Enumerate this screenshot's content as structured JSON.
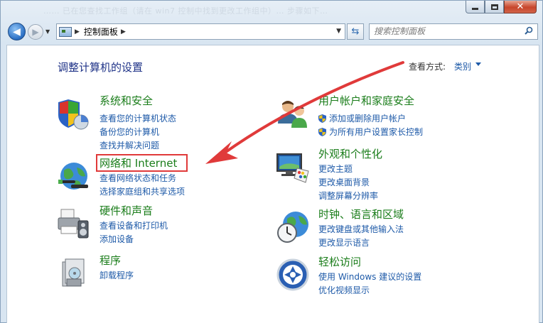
{
  "window": {
    "title_blurred": "…… 已在您查找工作组（请在 win7 控制中找到更改工作组中）… 步骤如下…",
    "minimize_label": "",
    "maximize_label": "",
    "close_label": "✕"
  },
  "nav": {
    "breadcrumb": "控制面板",
    "search_placeholder": "搜索控制面板"
  },
  "content": {
    "heading": "调整计算机的设置",
    "view_by_label": "查看方式:",
    "view_by_value": "类别"
  },
  "categories": {
    "system": {
      "title": "系统和安全",
      "links": [
        "查看您的计算机状态",
        "备份您的计算机",
        "查找并解决问题"
      ]
    },
    "network": {
      "title": "网络和 Internet",
      "links": [
        "查看网络状态和任务",
        "选择家庭组和共享选项"
      ]
    },
    "hardware": {
      "title": "硬件和声音",
      "links": [
        "查看设备和打印机",
        "添加设备"
      ]
    },
    "programs": {
      "title": "程序",
      "links": [
        "卸载程序"
      ]
    },
    "users": {
      "title": "用户帐户和家庭安全",
      "links": [
        "添加或删除用户帐户",
        "为所有用户设置家长控制"
      ]
    },
    "appearance": {
      "title": "外观和个性化",
      "links": [
        "更改主题",
        "更改桌面背景",
        "调整屏幕分辨率"
      ]
    },
    "clock": {
      "title": "时钟、语言和区域",
      "links": [
        "更改键盘或其他输入法",
        "更改显示语言"
      ]
    },
    "ease": {
      "title": "轻松访问",
      "links": [
        "使用 Windows 建议的设置",
        "优化视频显示"
      ]
    }
  },
  "colors": {
    "category_title": "#1a7d1a",
    "link": "#1e5aa8",
    "heading": "#1e3287",
    "annotation_red": "#e03a3a"
  }
}
